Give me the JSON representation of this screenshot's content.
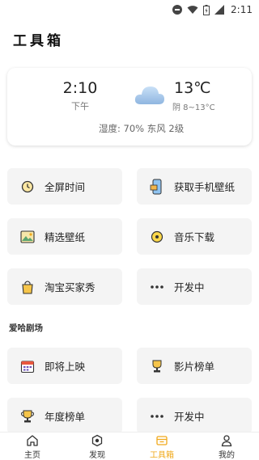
{
  "status_bar": {
    "time": "2:11"
  },
  "page": {
    "title": "工具箱"
  },
  "weather": {
    "clock_time": "2:10",
    "clock_period": "下午",
    "temperature": "13℃",
    "range": "阴 8~13°C",
    "humidity_wind": "湿度: 70% 东风 2级"
  },
  "tools": [
    {
      "label": "全屏时间",
      "icon": "clock-icon"
    },
    {
      "label": "获取手机壁纸",
      "icon": "phone-wallpaper-icon"
    },
    {
      "label": "精选壁纸",
      "icon": "image-icon"
    },
    {
      "label": "音乐下载",
      "icon": "music-disc-icon"
    },
    {
      "label": "淘宝买家秀",
      "icon": "shopping-bag-icon"
    },
    {
      "label": "开发中",
      "icon": "more-dots-icon"
    }
  ],
  "section": {
    "title": "爱哈剧场"
  },
  "theater": [
    {
      "label": "即将上映",
      "icon": "calendar-icon"
    },
    {
      "label": "影片榜单",
      "icon": "trophy-icon"
    },
    {
      "label": "年度榜单",
      "icon": "cup-icon"
    },
    {
      "label": "开发中",
      "icon": "more-dots-icon"
    }
  ],
  "bottom_nav": {
    "items": [
      {
        "label": "主页",
        "icon": "home-icon"
      },
      {
        "label": "发现",
        "icon": "discover-icon"
      },
      {
        "label": "工具箱",
        "icon": "toolbox-icon",
        "active": true
      },
      {
        "label": "我的",
        "icon": "profile-icon"
      }
    ]
  },
  "colors": {
    "accent": "#f0a91b",
    "card": "#f4f4f4"
  }
}
